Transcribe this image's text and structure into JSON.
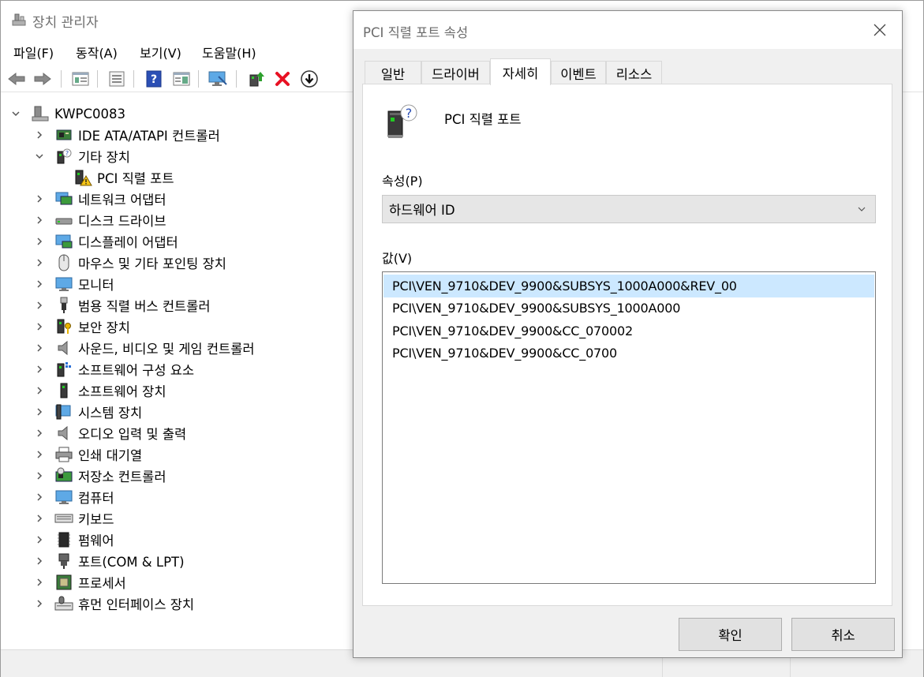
{
  "main_window": {
    "title": "장치 관리자",
    "menu": [
      "파일(F)",
      "동작(A)",
      "보기(V)",
      "도움말(H)"
    ],
    "toolbar_icons": [
      "back-icon",
      "forward-icon",
      "show-hide-tree-icon",
      "properties-icon",
      "help-icon",
      "action-pane-icon",
      "scan-hardware-icon",
      "update-driver-icon",
      "uninstall-icon",
      "disable-device-icon"
    ],
    "tree": {
      "root": "KWPC0083",
      "categories": [
        {
          "label": "IDE ATA/ATAPI 컨트롤러",
          "icon": "ide-controller-icon",
          "expanded": false
        },
        {
          "label": "기타 장치",
          "icon": "other-devices-icon",
          "expanded": true,
          "children": [
            {
              "label": "PCI 직렬 포트",
              "icon": "warning-device-icon"
            }
          ]
        },
        {
          "label": "네트워크 어댑터",
          "icon": "network-adapter-icon",
          "expanded": false
        },
        {
          "label": "디스크 드라이브",
          "icon": "disk-drive-icon",
          "expanded": false
        },
        {
          "label": "디스플레이 어댑터",
          "icon": "display-adapter-icon",
          "expanded": false
        },
        {
          "label": "마우스 및 기타 포인팅 장치",
          "icon": "mouse-icon",
          "expanded": false
        },
        {
          "label": "모니터",
          "icon": "monitor-icon",
          "expanded": false
        },
        {
          "label": "범용 직렬 버스 컨트롤러",
          "icon": "usb-icon",
          "expanded": false
        },
        {
          "label": "보안 장치",
          "icon": "security-device-icon",
          "expanded": false
        },
        {
          "label": "사운드, 비디오 및 게임 컨트롤러",
          "icon": "speaker-icon",
          "expanded": false
        },
        {
          "label": "소프트웨어 구성 요소",
          "icon": "software-component-icon",
          "expanded": false
        },
        {
          "label": "소프트웨어 장치",
          "icon": "software-device-icon",
          "expanded": false
        },
        {
          "label": "시스템 장치",
          "icon": "system-device-icon",
          "expanded": false
        },
        {
          "label": "오디오 입력 및 출력",
          "icon": "audio-icon",
          "expanded": false
        },
        {
          "label": "인쇄 대기열",
          "icon": "printer-icon",
          "expanded": false
        },
        {
          "label": "저장소 컨트롤러",
          "icon": "storage-controller-icon",
          "expanded": false
        },
        {
          "label": "컴퓨터",
          "icon": "computer-icon",
          "expanded": false
        },
        {
          "label": "키보드",
          "icon": "keyboard-icon",
          "expanded": false
        },
        {
          "label": "펌웨어",
          "icon": "firmware-icon",
          "expanded": false
        },
        {
          "label": "포트(COM & LPT)",
          "icon": "port-icon",
          "expanded": false
        },
        {
          "label": "프로세서",
          "icon": "processor-icon",
          "expanded": false
        },
        {
          "label": "휴먼 인터페이스 장치",
          "icon": "hid-icon",
          "expanded": false
        }
      ]
    }
  },
  "dialog": {
    "title": "PCI 직렬 포트 속성",
    "tabs": [
      "일반",
      "드라이버",
      "자세히",
      "이벤트",
      "리소스"
    ],
    "active_tab": "자세히",
    "device_name": "PCI 직렬 포트",
    "property_label": "속성(P)",
    "property_selected": "하드웨어 ID",
    "value_label": "값(V)",
    "values": [
      "PCI\\VEN_9710&DEV_9900&SUBSYS_1000A000&REV_00",
      "PCI\\VEN_9710&DEV_9900&SUBSYS_1000A000",
      "PCI\\VEN_9710&DEV_9900&CC_070002",
      "PCI\\VEN_9710&DEV_9900&CC_0700"
    ],
    "selected_value_index": 0,
    "ok_label": "확인",
    "cancel_label": "취소"
  },
  "colors": {
    "selection": "#cce8ff",
    "dialog_bg": "#f0f0f0",
    "button_bg": "#e1e1e1",
    "delete_red": "#e81123",
    "help_blue": "#2b4fb5"
  }
}
